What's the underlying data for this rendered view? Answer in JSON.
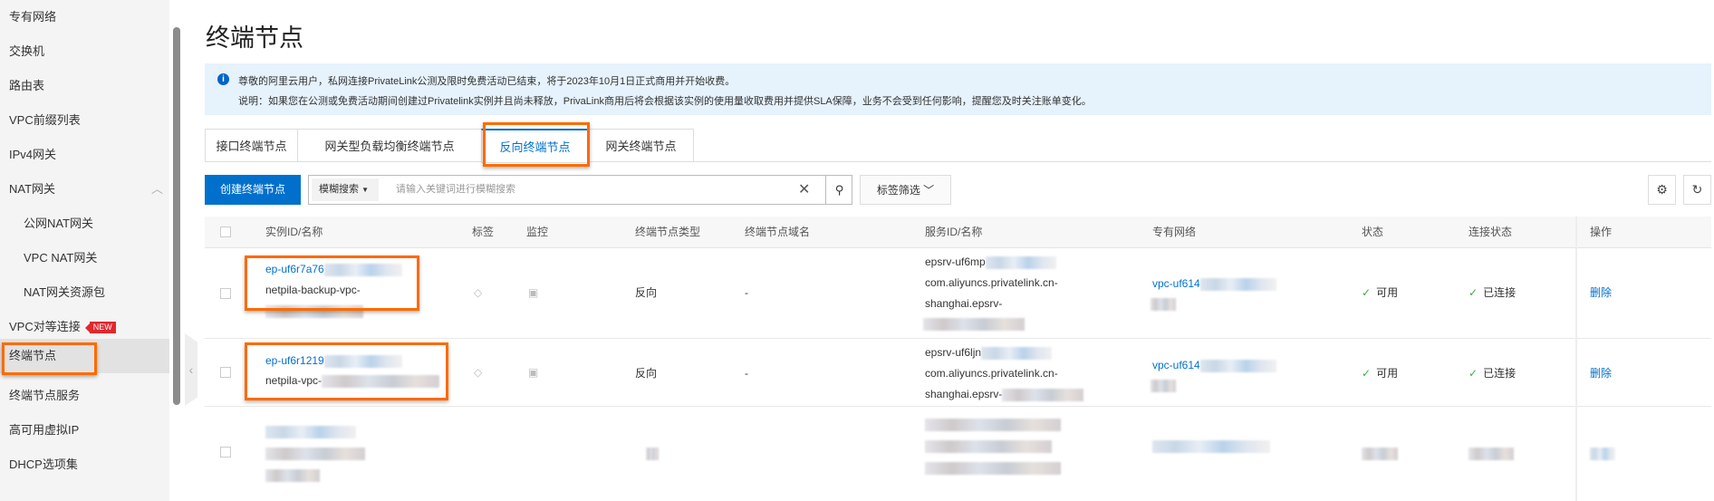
{
  "sidebar": {
    "items": [
      "专有网络",
      "交换机",
      "路由表",
      "VPC前缀列表",
      "IPv4网关",
      "NAT网关",
      "公网NAT网关",
      "VPC NAT网关",
      "NAT网关资源包",
      "VPC对等连接",
      "终端节点",
      "终端节点服务",
      "高可用虚拟IP",
      "DHCP选项集"
    ],
    "new_badge": "NEW"
  },
  "page": {
    "title": "终端节点"
  },
  "notice": {
    "line1": "尊敬的阿里云用户，私网连接PrivateLink公测及限时免费活动已结束，将于2023年10月1日正式商用并开始收费。",
    "line2": "说明：如果您在公测或免费活动期间创建过Privatelink实例并且尚未释放，PrivaLink商用后将会根据该实例的使用量收取费用并提供SLA保障，业务不会受到任何影响，提醒您及时关注账单变化。"
  },
  "tabs": [
    "接口终端节点",
    "网关型负载均衡终端节点",
    "反向终端节点",
    "网关终端节点"
  ],
  "toolbar": {
    "create": "创建终端节点",
    "search_mode": "模糊搜索",
    "search_placeholder": "请输入关键词进行模糊搜索",
    "tag_filter": "标签筛选"
  },
  "table": {
    "headers": [
      "实例ID/名称",
      "标签",
      "监控",
      "终端节点类型",
      "终端节点域名",
      "服务ID/名称",
      "专有网络",
      "状态",
      "连接状态",
      "操作"
    ],
    "rows": [
      {
        "id": "ep-uf6r7a76",
        "name": "netpila-backup-vpc-",
        "type": "反向",
        "domain": "-",
        "service_id": "epsrv-uf6mp",
        "service_name1": "com.aliyuncs.privatelink.cn-",
        "service_name2": "shanghai.epsrv-",
        "vpc": "vpc-uf614",
        "status": "可用",
        "conn": "已连接",
        "action": "删除"
      },
      {
        "id": "ep-uf6r1219",
        "name": "netpila-vpc-",
        "type": "反向",
        "domain": "-",
        "service_id": "epsrv-uf6ljn",
        "service_name1": "com.aliyuncs.privatelink.cn-",
        "service_name2": "shanghai.epsrv-",
        "vpc": "vpc-uf614",
        "status": "可用",
        "conn": "已连接",
        "action": "删除"
      }
    ]
  },
  "colors": {
    "accent": "#0070cc",
    "highlight": "#ff6a00"
  }
}
